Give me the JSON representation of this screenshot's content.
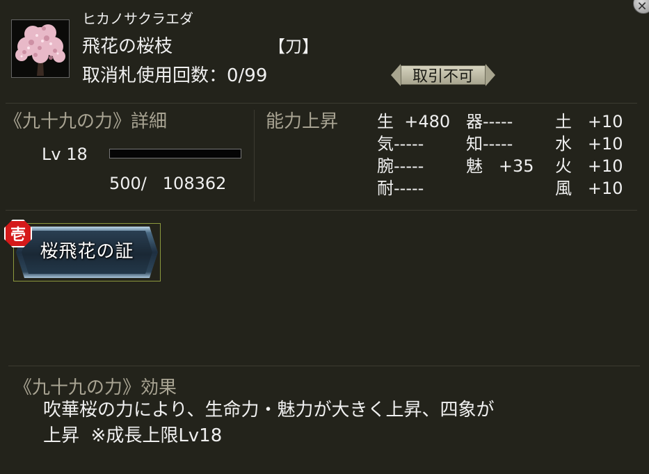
{
  "item": {
    "furigana": "ヒカノサクラエダ",
    "name": "飛花の桜枝",
    "category": "【刀】",
    "cancel_label": "取消札使用回数：0/99",
    "trade_badge": "取引不可"
  },
  "details": {
    "heading": "《九十九の力》詳細",
    "level": "Lv 18",
    "level_bar_fill": 0.0,
    "exp": "500/   108362"
  },
  "stats": {
    "heading": "能力上昇",
    "rows": [
      {
        "a": "生  +480",
        "b": "器-----",
        "c": "土   +10"
      },
      {
        "a": "気-----",
        "b": "知-----",
        "c": "水   +10"
      },
      {
        "a": "腕-----",
        "b": "魅   +35",
        "c": "火   +10"
      },
      {
        "a": "耐-----",
        "b": "",
        "c": "風   +10"
      }
    ]
  },
  "skill": {
    "rank": "壱",
    "name": "桜飛花の証"
  },
  "effect": {
    "heading": "《九十九の力》効果",
    "line1": "吹華桜の力により、生命力・魅力が大きく上昇、四象が",
    "line2": "上昇  ※成長上限Lv18"
  },
  "colors": {
    "background": "#23231b",
    "heading": "#a9a493",
    "skill_rank": "#d51a1a"
  }
}
